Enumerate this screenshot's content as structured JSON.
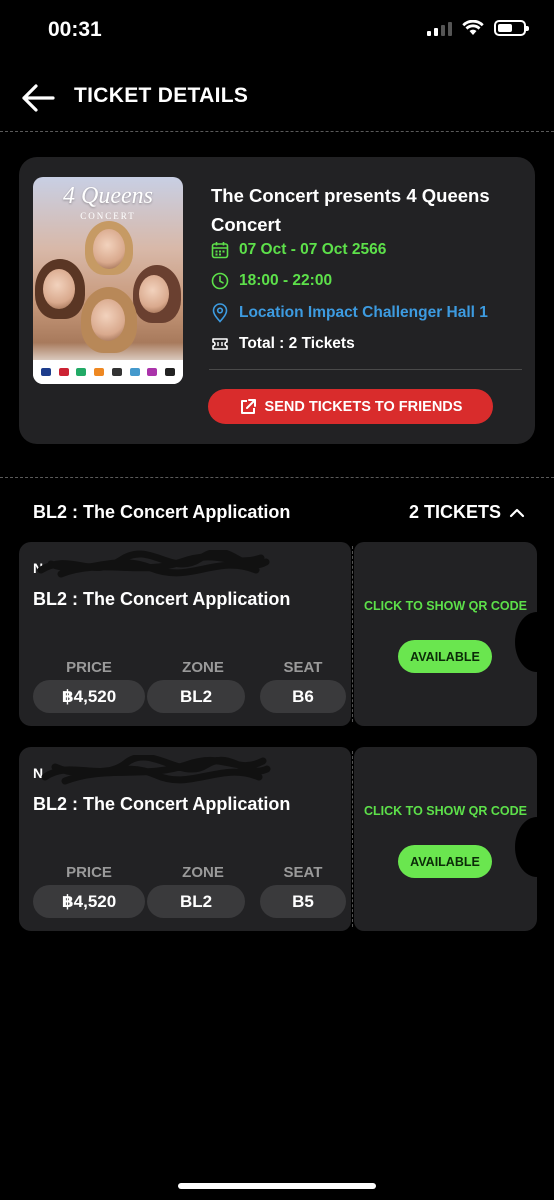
{
  "status_bar": {
    "time": "00:31"
  },
  "header": {
    "title": "TICKET DETAILS"
  },
  "event": {
    "poster": {
      "title": "4 Queens",
      "subtitle": "CONCERT"
    },
    "title": "The Concert presents 4 Queens Concert",
    "date": "07 Oct - 07 Oct 2566",
    "time": "18:00 - 22:00",
    "location": "Location Impact Challenger Hall 1",
    "total": "Total : 2 Tickets",
    "send_button": "SEND TICKETS TO FRIENDS"
  },
  "group": {
    "name": "BL2 : The Concert Application",
    "count": "2 TICKETS"
  },
  "labels": {
    "price": "PRICE",
    "zone": "ZONE",
    "seat": "SEAT"
  },
  "stub": {
    "show_qr": "CLICK TO SHOW QR CODE",
    "available": "AVAILABLE"
  },
  "tickets": [
    {
      "number": "N",
      "name": "BL2 : The Concert Application",
      "price": "฿4,520",
      "zone": "BL2",
      "seat": "B6"
    },
    {
      "number": "N",
      "name": "BL2 : The Concert Application",
      "price": "฿4,520",
      "zone": "BL2",
      "seat": "B5"
    }
  ],
  "colors": {
    "accent_green": "#5de04a",
    "accent_blue": "#3d9be0",
    "send_red": "#d92c2c",
    "card_bg": "#222224"
  }
}
